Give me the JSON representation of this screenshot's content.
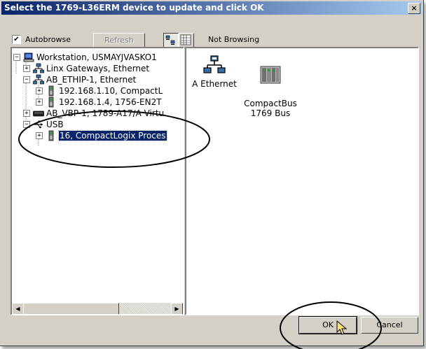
{
  "window": {
    "title": "Select the 1769-L36ERM device to update and click OK",
    "close_glyph": "×"
  },
  "toolbar": {
    "autobrowse_checked": true,
    "autobrowse_label": "Autobrowse",
    "refresh_label": "Refresh",
    "browse_status": "Not Browsing"
  },
  "tree": {
    "nodes": [
      {
        "expander": "−",
        "icon": "workstation-icon",
        "label": "Workstation, USMAYJVASKO1"
      },
      {
        "expander": "+",
        "icon": "network-icon",
        "label": "Linx Gateways, Ethernet"
      },
      {
        "expander": "−",
        "icon": "network-icon",
        "label": "AB_ETHIP-1, Ethernet"
      },
      {
        "expander": "+",
        "icon": "module-icon",
        "label": "192.168.1.10, CompactL"
      },
      {
        "expander": "+",
        "icon": "module-icon",
        "label": "192.168.1.4, 1756-EN2T"
      },
      {
        "expander": "+",
        "icon": "backplane-icon",
        "label": "AB_VBP-1, 1789-A17/A Virtu"
      },
      {
        "expander": "−",
        "icon": "usb-icon",
        "label": "USB"
      },
      {
        "expander": "+",
        "icon": "module-icon",
        "label": "16, CompactLogix Proces",
        "selected": true
      }
    ]
  },
  "devices": [
    {
      "icon": "ethernet-port-icon",
      "label": "A Ethernet"
    },
    {
      "icon": "compactbus-icon",
      "label": "CompactBus\n1769 Bus"
    }
  ],
  "buttons": {
    "ok_label": "OK",
    "cancel_label": "Cancel"
  },
  "colors": {
    "title_gradient_start": "#0a246a",
    "title_gradient_end": "#a6caf0",
    "selection": "#0a246a",
    "face": "#d4d0c8"
  }
}
